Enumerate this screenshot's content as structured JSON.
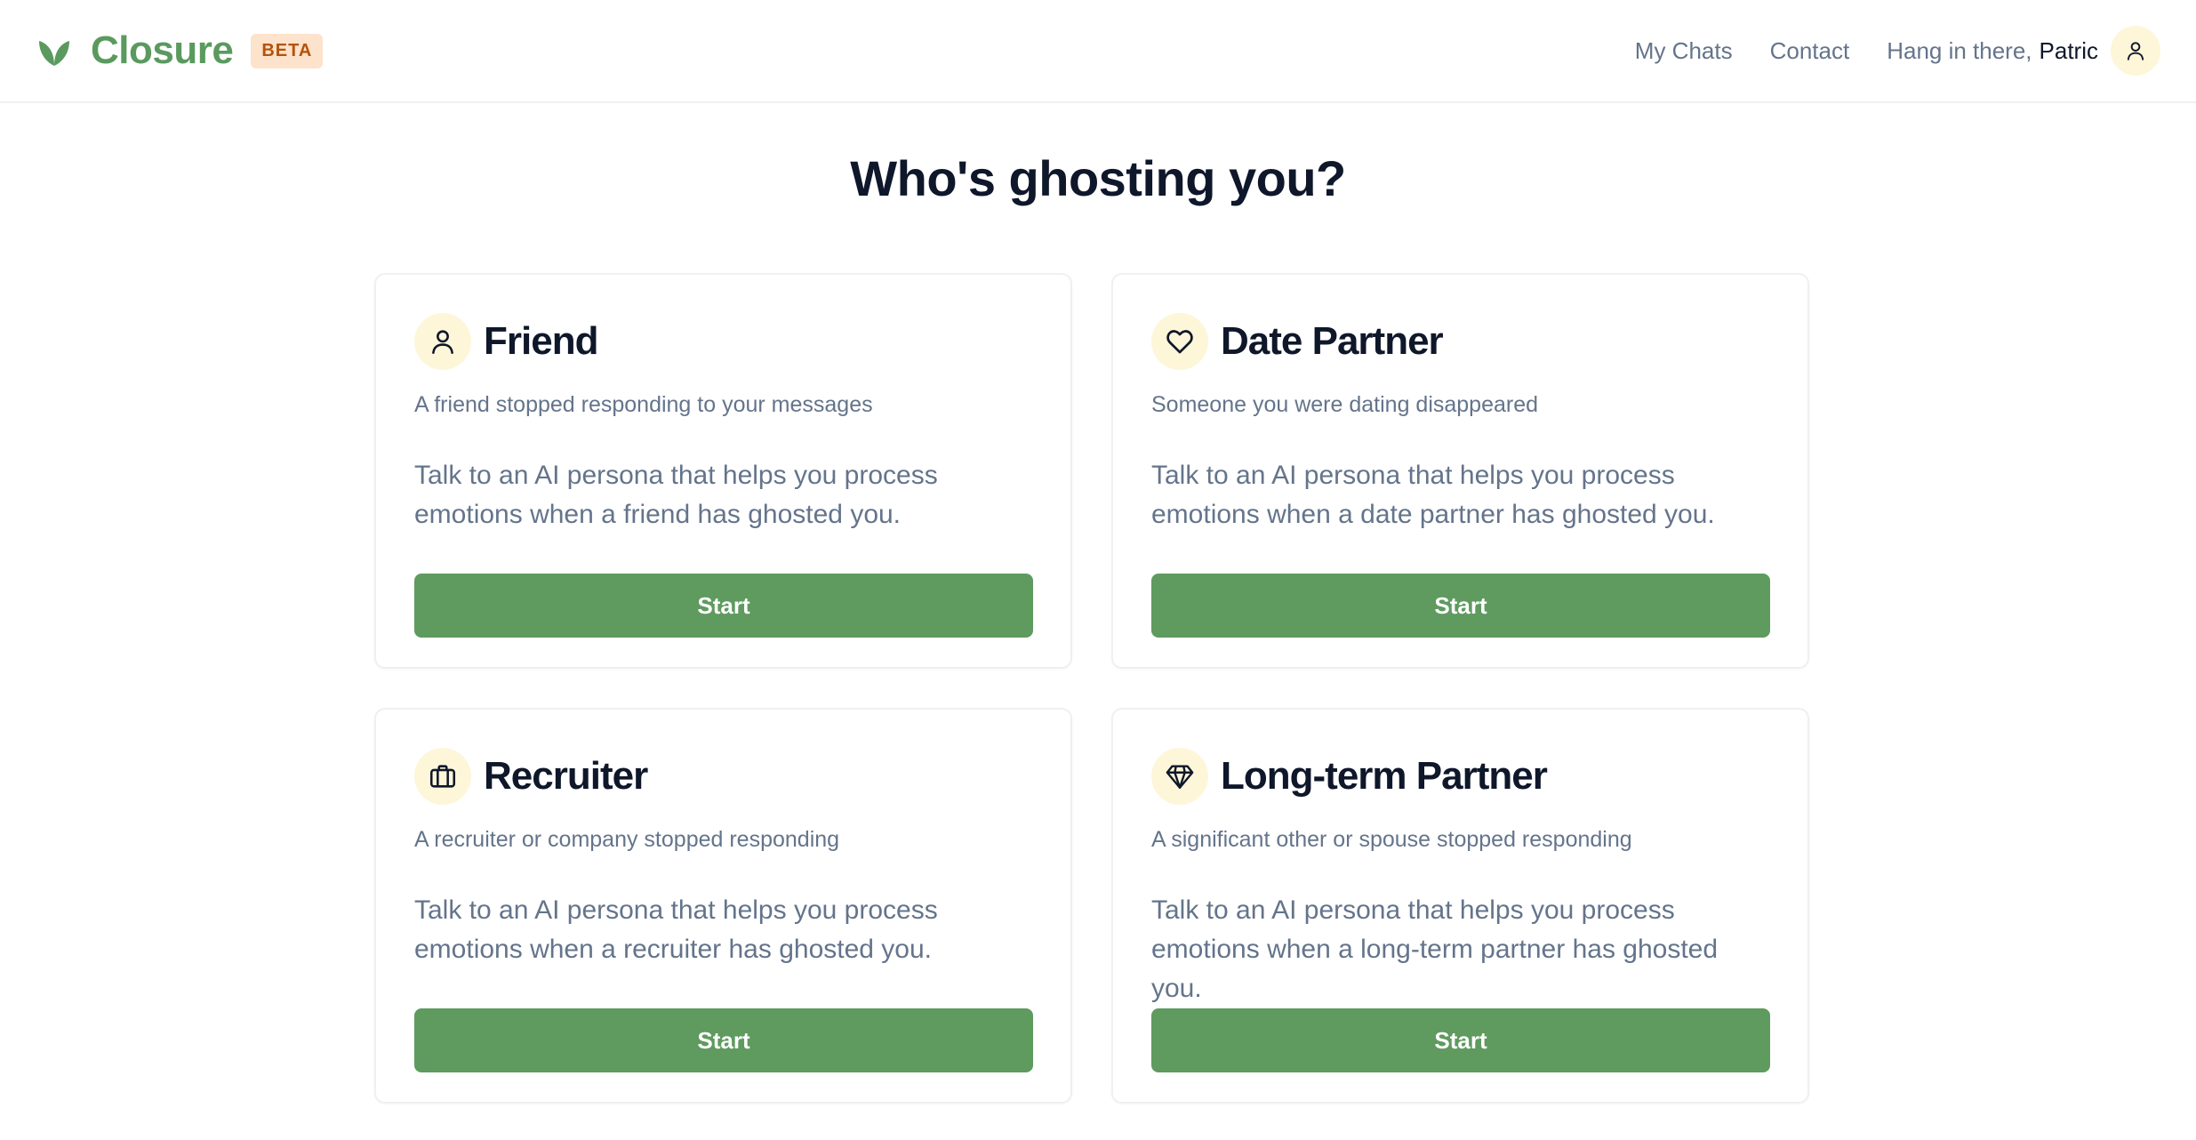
{
  "header": {
    "brand_name": "Closure",
    "beta_label": "BETA",
    "logo_icon": "leaf-icon",
    "nav": {
      "my_chats": "My Chats",
      "contact": "Contact"
    },
    "greeting_prefix": "Hang in there,",
    "user_name": "Patric",
    "avatar_icon": "user-icon"
  },
  "main": {
    "title": "Who's ghosting you?",
    "cards": [
      {
        "icon": "user-icon",
        "title": "Friend",
        "subtitle": "A friend stopped responding to your messages",
        "description": "Talk to an AI persona that helps you process emotions when a friend has ghosted you.",
        "button": "Start"
      },
      {
        "icon": "heart-icon",
        "title": "Date Partner",
        "subtitle": "Someone you were dating disappeared",
        "description": "Talk to an AI persona that helps you process emotions when a date partner has ghosted you.",
        "button": "Start"
      },
      {
        "icon": "briefcase-icon",
        "title": "Recruiter",
        "subtitle": "A recruiter or company stopped responding",
        "description": "Talk to an AI persona that helps you process emotions when a recruiter has ghosted you.",
        "button": "Start"
      },
      {
        "icon": "diamond-icon",
        "title": "Long-term Partner",
        "subtitle": "A significant other or spouse stopped responding",
        "description": "Talk to an AI persona that helps you process emotions when a long-term partner has ghosted you.",
        "button": "Start"
      }
    ]
  },
  "colors": {
    "brand": "#5a9a5e",
    "button": "#5f9a5f",
    "icon_bg": "#fdf6d8",
    "beta_bg": "#fde2cc",
    "beta_text": "#b45309",
    "muted_text": "#64748b"
  }
}
